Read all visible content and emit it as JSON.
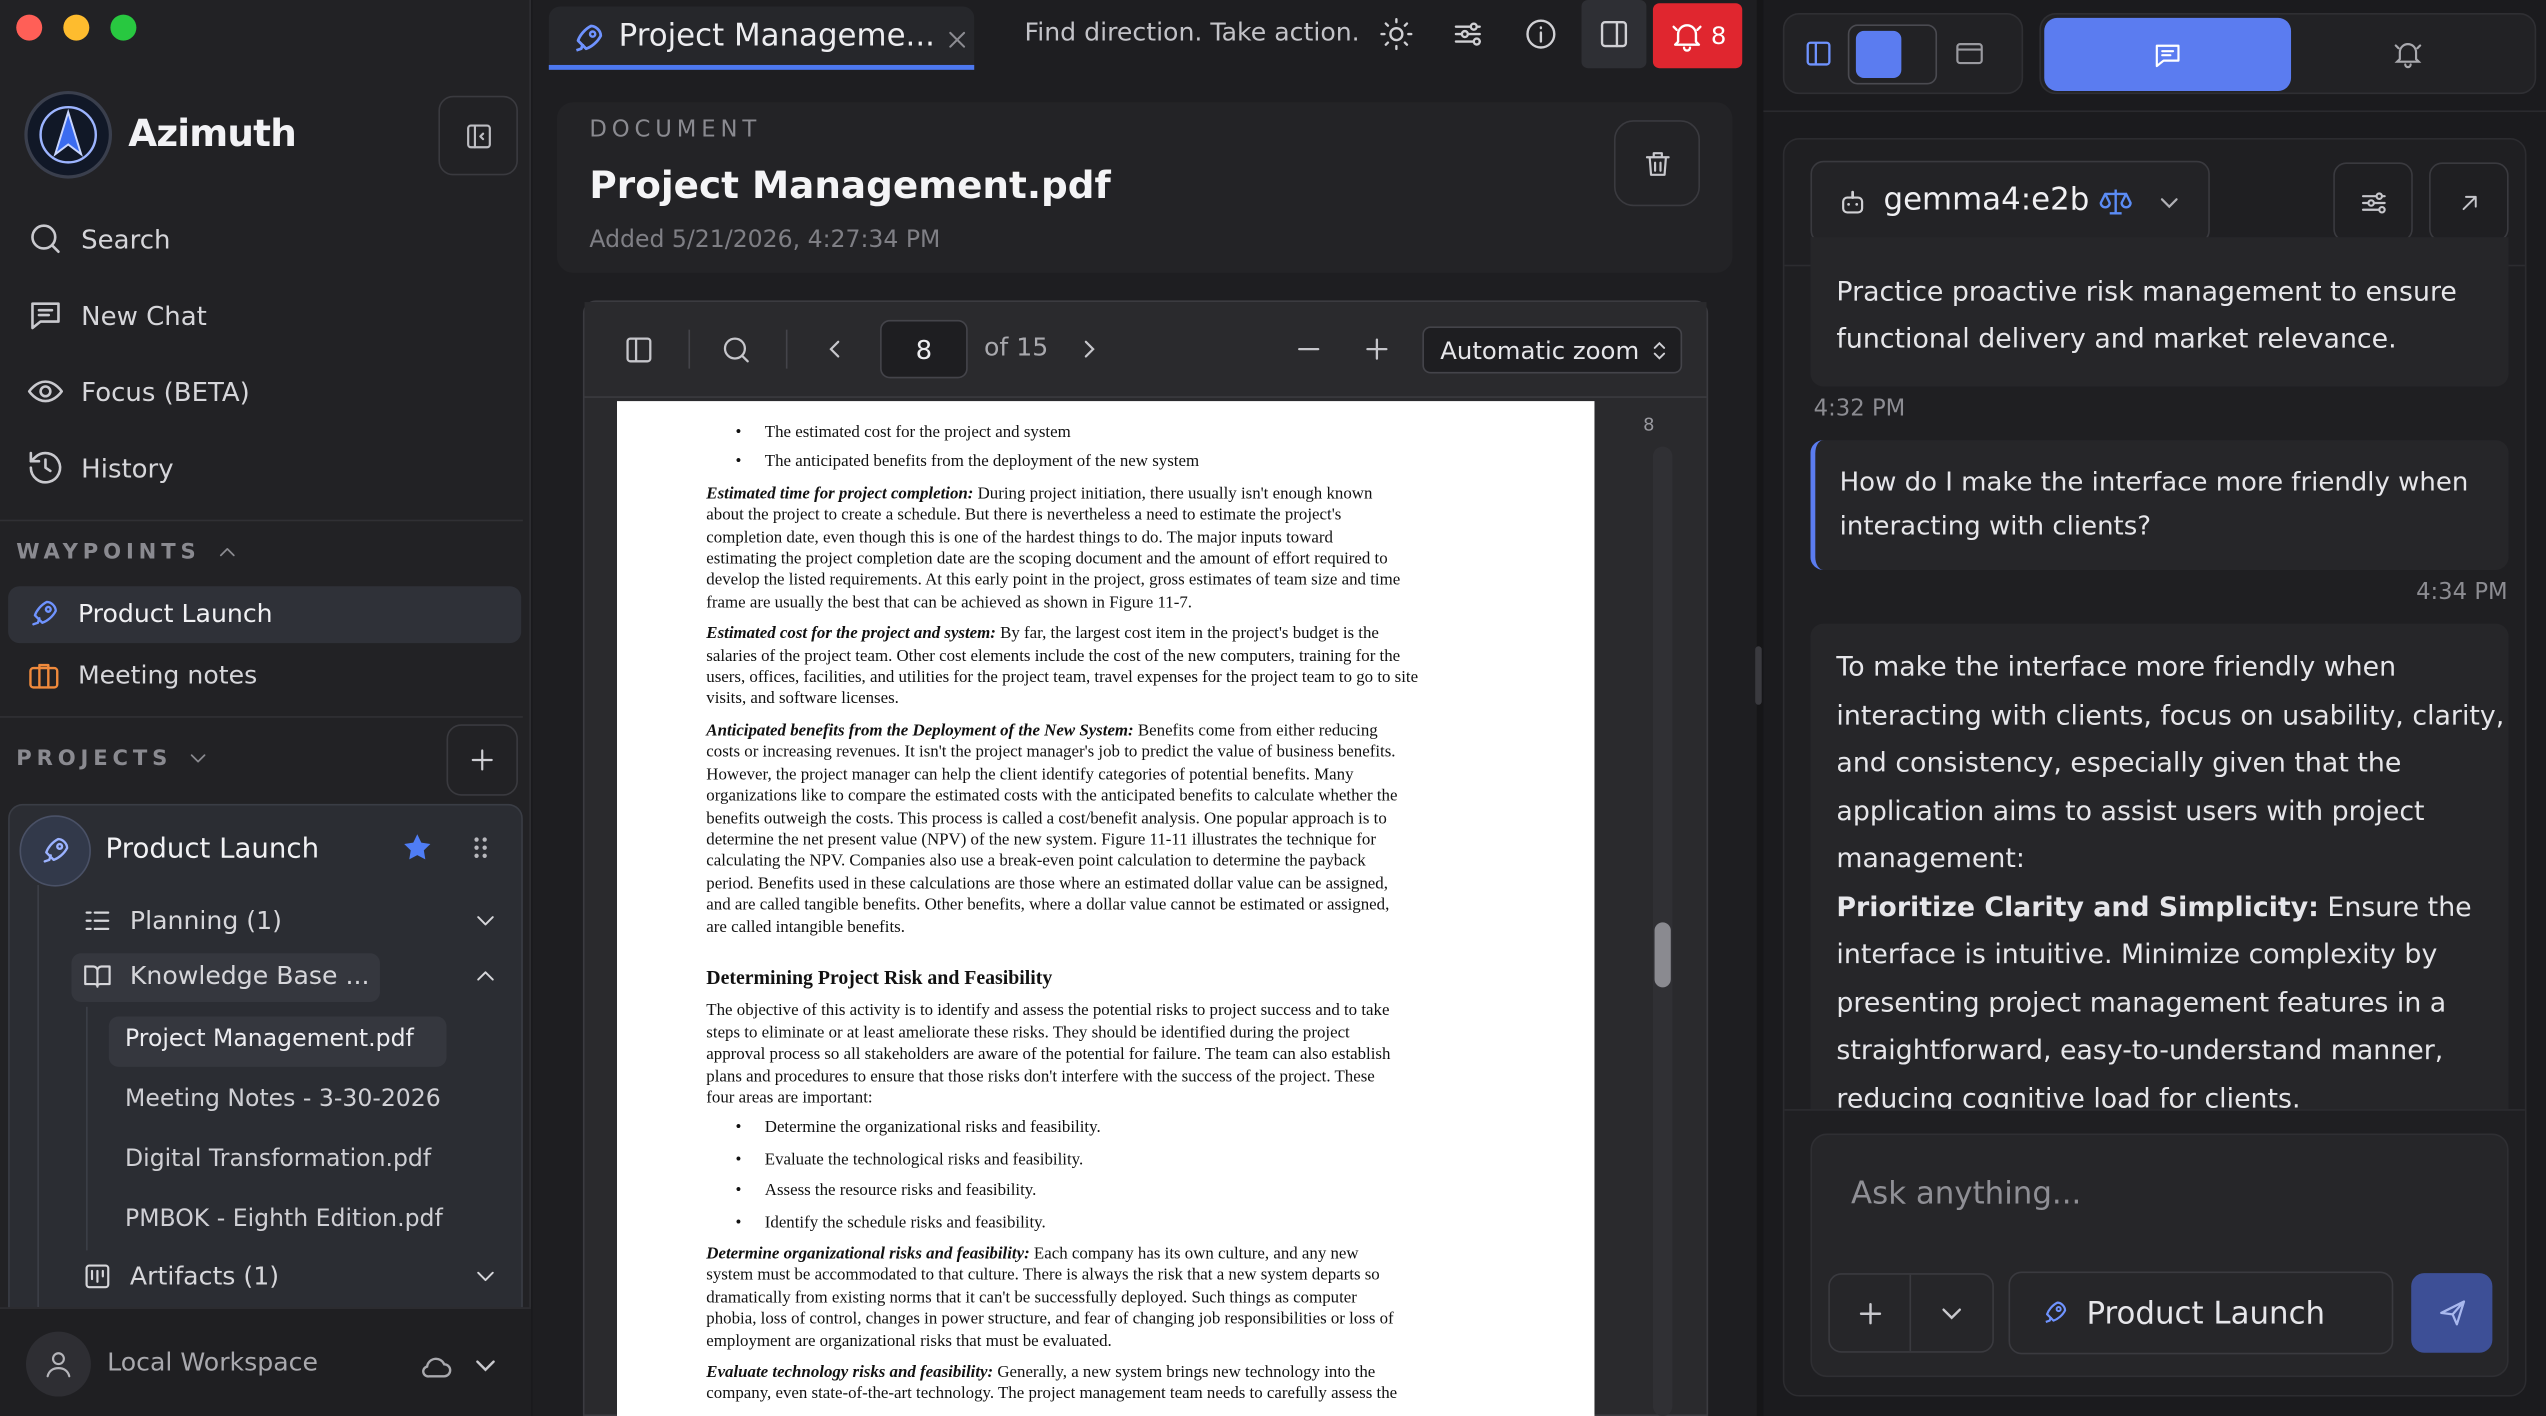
{
  "app": {
    "name": "Azimuth"
  },
  "sidebar": {
    "nav": [
      {
        "label": "Search",
        "icon": "search-icon"
      },
      {
        "label": "New Chat",
        "icon": "chat-icon"
      },
      {
        "label": "Focus (BETA)",
        "icon": "eye-icon"
      },
      {
        "label": "History",
        "icon": "history-icon"
      }
    ],
    "waypoints_label": "WAYPOINTS",
    "waypoints": [
      {
        "label": "Product Launch",
        "icon": "rocket-icon"
      },
      {
        "label": "Meeting notes",
        "icon": "briefcase-icon"
      }
    ],
    "projects_label": "PROJECTS",
    "project": {
      "name": "Product Launch",
      "groups": [
        {
          "label": "Planning (1)"
        },
        {
          "label": "Knowledge Base ..."
        },
        {
          "label": "Artifacts (1)"
        }
      ],
      "files": [
        "Project Management.pdf",
        "Meeting Notes - 3-30-2026",
        "Digital Transformation.pdf",
        "PMBOK - Eighth Edition.pdf"
      ]
    },
    "workspace": "Local Workspace"
  },
  "tabbar": {
    "tab_title": "Project Manageme...",
    "tagline": "Find direction. Take action.",
    "notification_count": "8"
  },
  "document": {
    "eyebrow": "DOCUMENT",
    "title": "Project Management.pdf",
    "added": "Added 5/21/2026, 4:27:34 PM"
  },
  "viewer": {
    "page": "8",
    "of": "of 15",
    "zoom": "Automatic zoom",
    "thumb_page": "8"
  },
  "pdf": {
    "bullets_top": [
      "The estimated cost for the project and system",
      "The anticipated benefits from the deployment of the new system"
    ],
    "p1_head": "Estimated time for project completion:",
    "p1_lines": [
      " During project initiation, there usually isn't enough known",
      "about the project to create a schedule. But there is nevertheless a need to estimate the project's",
      "completion date, even though this is one of the hardest things to do. The major inputs toward",
      "estimating the project completion date are the scoping document and the amount of effort required to",
      "develop the listed requirements. At this early point in the project, gross estimates of team size and time",
      "frame are usually the best that can be achieved as shown in Figure 11-7."
    ],
    "p2_head": "Estimated cost for the project and system:",
    "p2_lines": [
      " By far, the largest cost item in the project's budget is the",
      "salaries of the project team. Other cost elements include the cost of the new computers, training for the",
      "users, offices, facilities, and utilities for the project team, travel expenses for the project team to go to site",
      "visits, and software licenses."
    ],
    "p3_head": "Anticipated benefits from the Deployment of the New System:",
    "p3_lines": [
      " Benefits come from either reducing",
      "costs or increasing revenues. It isn't the project manager's job to predict the value of business benefits.",
      "However, the project manager can help the client identify categories of potential benefits. Many",
      "organizations like to compare the estimated costs with the anticipated benefits to calculate whether the",
      "benefits outweigh the costs. This process is called a cost/benefit analysis. One popular approach is to",
      "determine the net present value (NPV) of the new system. Figure 11-11 illustrates the technique for",
      "calculating the NPV.  Companies also use a break-even point calculation to determine the payback",
      "period. Benefits used in these calculations are those where an estimated dollar value can be assigned,",
      "and are called tangible benefits. Other benefits, where a dollar value cannot be estimated or assigned,",
      "are called intangible benefits."
    ],
    "heading": "Determining Project Risk and Feasibility",
    "p4_lines": [
      "The objective of this activity is to identify and assess the potential risks to project success and to take",
      "steps to eliminate or at least ameliorate these risks. They should be identified during the project",
      "approval process so all stakeholders are aware of the potential for failure. The team can also establish",
      "plans and procedures to ensure that those risks don't interfere with the success of the project. These",
      "four areas are important:"
    ],
    "bullets_mid": [
      "Determine the organizational risks and feasibility.",
      "Evaluate the technological risks and feasibility.",
      "Assess the resource risks and feasibility.",
      "Identify the schedule risks and feasibility."
    ],
    "p5_head": "Determine organizational risks and feasibility:",
    "p5_lines": [
      " Each company has its own culture, and any new",
      "system must be accommodated to that culture. There is always the risk that a new system departs so",
      "dramatically from existing norms that it can't be successfully deployed. Such things as computer",
      "phobia, loss of control, changes in power structure, and fear of changing job responsibilities or loss of",
      "employment are organizational risks that must be evaluated."
    ],
    "p6_head": "Evaluate technology risks and feasibility:",
    "p6_lines": [
      " Generally, a new system brings new technology into the",
      "company, even state-of-the-art technology. The project management team needs to carefully assess the"
    ]
  },
  "chat": {
    "model": "gemma4:e2b",
    "messages": [
      {
        "role": "assistant",
        "text": [
          "Practice proactive risk management to ensure",
          "functional delivery and market relevance."
        ],
        "time": "4:32 PM"
      },
      {
        "role": "user",
        "text": [
          "How do I make the interface more friendly when",
          "interacting with clients?"
        ],
        "time": "4:34 PM"
      },
      {
        "role": "assistant",
        "text": [
          "To make the interface more friendly when",
          "interacting with clients, focus on usability, clarity,",
          "and consistency, especially given that the",
          "application aims to assist users with project",
          "management:"
        ],
        "bold": "Prioritize Clarity and Simplicity:",
        "after_bold": " Ensure the",
        "rest": [
          "interface is intuitive. Minimize complexity by",
          "presenting project management features in a",
          "straightforward, easy-to-understand manner,",
          "reducing cognitive load for clients."
        ]
      }
    ],
    "input_placeholder": "Ask anything...",
    "context": "Product Launch"
  },
  "colors": {
    "accent": "#5b7cf0",
    "alert": "#e0262f",
    "star": "#4f7df5"
  }
}
